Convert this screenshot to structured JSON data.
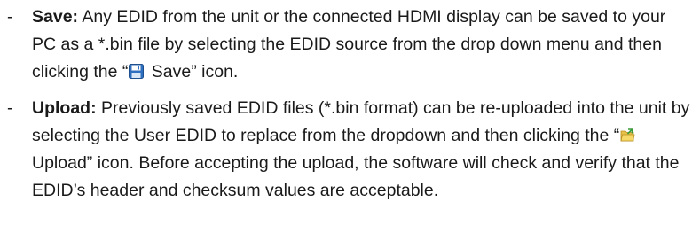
{
  "items": [
    {
      "dash": "-",
      "term": "Save:",
      "text_a": " Any EDID from the unit or the connected HDMI display can be saved to your PC as a *.bin file by selecting the EDID source from the drop down menu and then clicking the “",
      "icon": "save-icon",
      "text_b": " Save” icon."
    },
    {
      "dash": "-",
      "term": "Upload:",
      "text_a": " Previously saved EDID files (*.bin format) can be re-uploaded into the unit by selecting the User EDID to replace from the dropdown and then clicking the “",
      "icon": "upload-folder-icon",
      "text_b": " Upload” icon. Before accepting the upload, the software will check and verify that the EDID’s header and checksum values are acceptable."
    }
  ]
}
